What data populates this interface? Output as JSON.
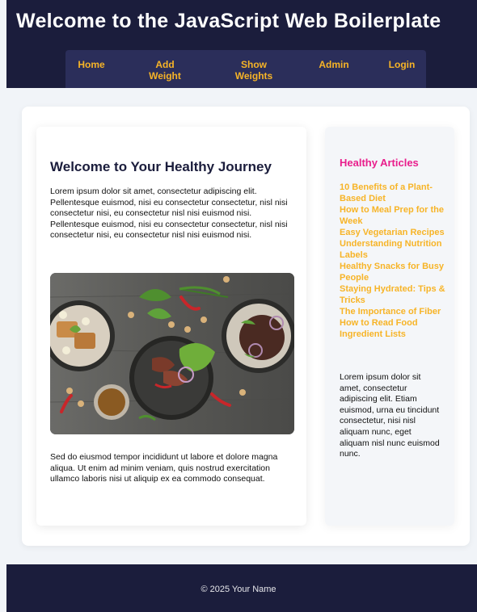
{
  "header": {
    "title": "Welcome to the JavaScript Web Boilerplate",
    "nav": [
      {
        "label": "Home"
      },
      {
        "label": "Add\nWeight"
      },
      {
        "label": "Show\nWeights"
      },
      {
        "label": "Admin"
      },
      {
        "label": "Login"
      }
    ]
  },
  "main": {
    "heading": "Welcome to Your Healthy Journey",
    "intro": "Lorem ipsum dolor sit amet, consectetur adipiscing elit. Pellentesque euismod, nisi eu consectetur consectetur, nisl nisi consectetur nisi, eu consectetur nisl nisi euismod nisi. Pellentesque euismod, nisi eu consectetur consectetur, nisl nisi consectetur nisi, eu consectetur nisl nisi euismod nisi.",
    "outro": "Sed do eiusmod tempor incididunt ut labore et dolore magna aliqua. Ut enim ad minim veniam, quis nostrud exercitation ullamco laboris nisi ut aliquip ex ea commodo consequat."
  },
  "aside": {
    "heading": "Healthy Articles",
    "articles": [
      "10 Benefits of a Plant-Based Diet",
      "How to Meal Prep for the Week",
      "Easy Vegetarian Recipes",
      "Understanding Nutrition Labels",
      "Healthy Snacks for Busy People",
      "Staying Hydrated: Tips & Tricks",
      "The Importance of Fiber",
      "How to Read Food Ingredient Lists"
    ],
    "text": "Lorem ipsum dolor sit amet, consectetur adipiscing elit. Etiam euismod, urna eu tincidunt consectetur, nisi nisl aliquam nunc, eget aliquam nisl nunc euismod nunc."
  },
  "footer": {
    "text": "© 2025 Your Name"
  },
  "colors": {
    "header_bg": "#1b1d3c",
    "nav_bg": "#2b2e5a",
    "nav_text": "#f7b427",
    "heading_accent": "#e91e8c",
    "link": "#f7b427"
  }
}
